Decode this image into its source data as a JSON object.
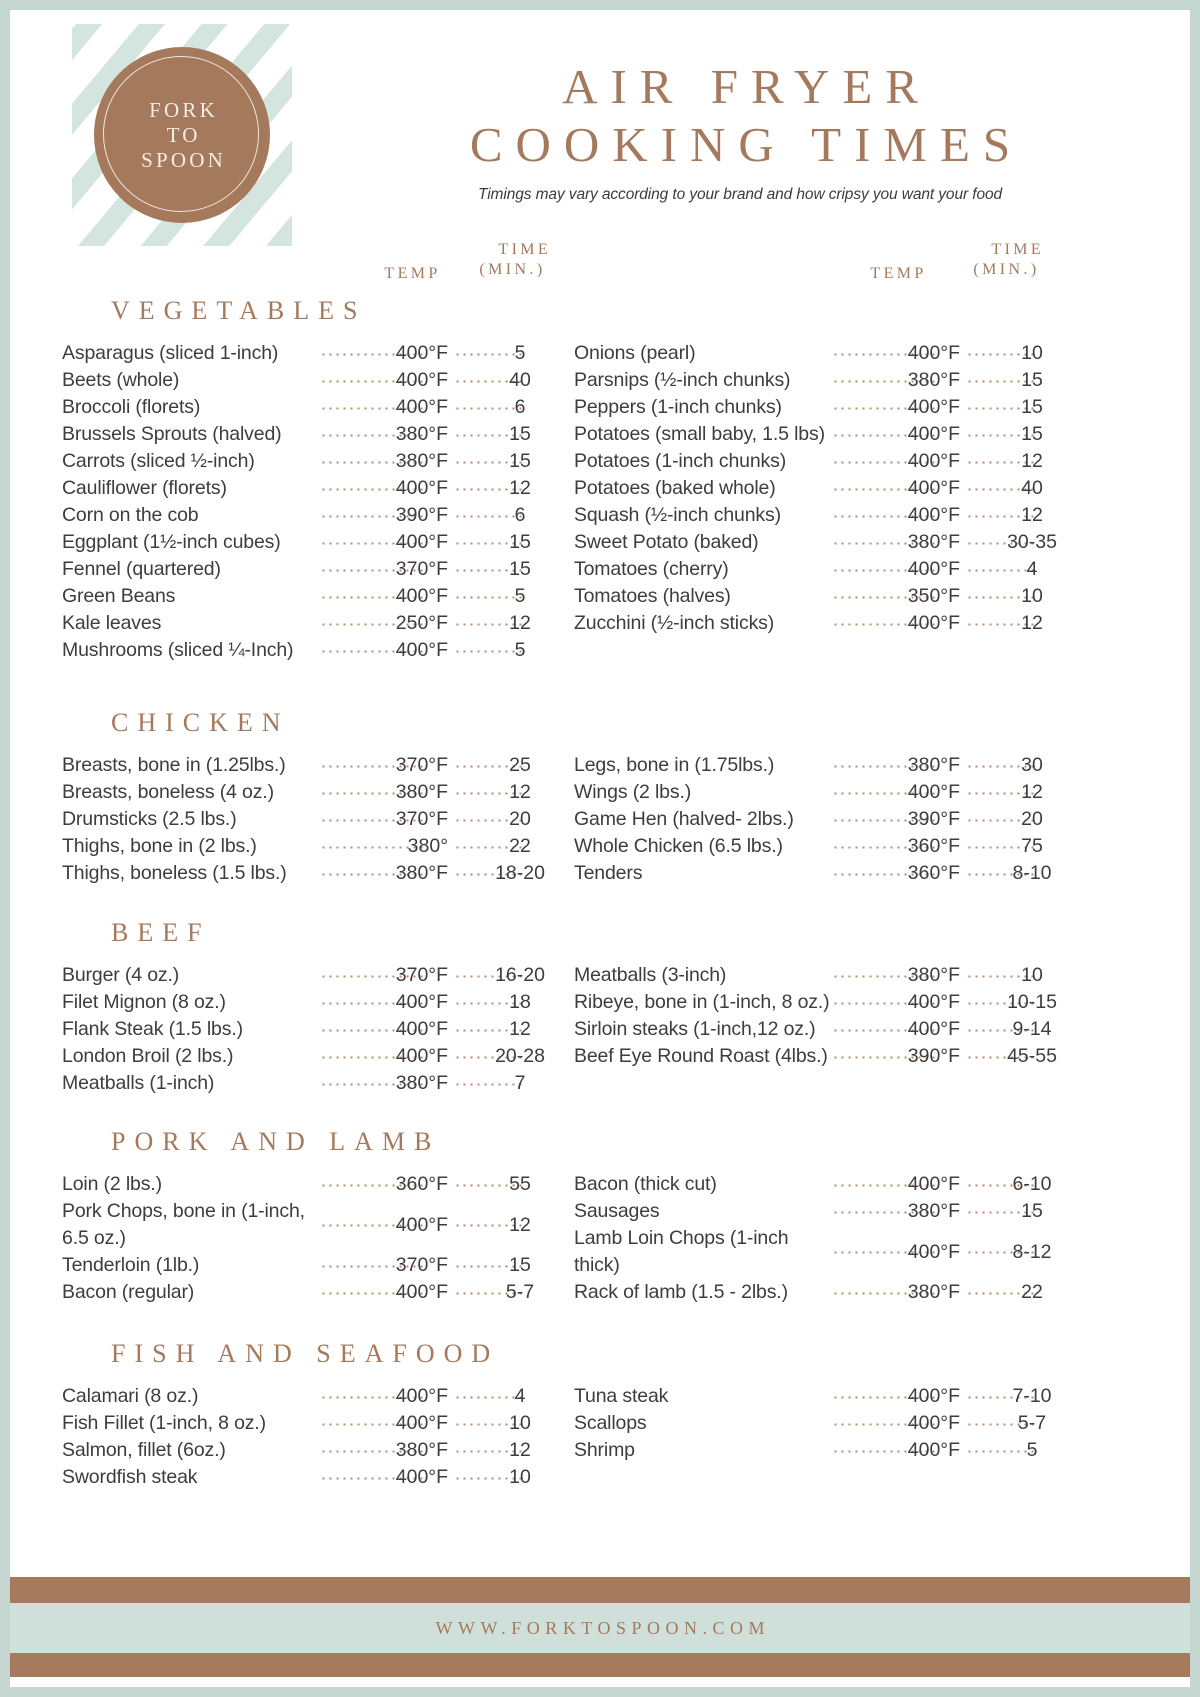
{
  "brand": {
    "logo_line1": "FORK",
    "logo_line2": "TO",
    "logo_line3": "SPOON",
    "website": "WWW.FORKTOSPOON.COM"
  },
  "header": {
    "title_line1": "AIR FRYER",
    "title_line2": "COOKING TIMES",
    "subtitle": "Timings may vary according to your brand and how cripsy you want your food",
    "col_temp_left": "TEMP",
    "col_time_left_1": "TIME",
    "col_time_left_2": "(MIN.)",
    "col_temp_right": "TEMP",
    "col_time_right_1": "TIME",
    "col_time_right_2": "(MIN.)"
  },
  "colors": {
    "brown": "#a5795c",
    "mint": "#cfe0da",
    "text": "#3d3d3d",
    "dots": "#b98a6c"
  },
  "sections": [
    {
      "title": "VEGETABLES",
      "left": [
        {
          "name": "Asparagus (sliced 1-inch)",
          "temp": "400°F",
          "time": "5"
        },
        {
          "name": "Beets (whole)",
          "temp": "400°F",
          "time": "40"
        },
        {
          "name": "Broccoli (florets)",
          "temp": "400°F",
          "time": "6"
        },
        {
          "name": "Brussels Sprouts (halved)",
          "temp": "380°F",
          "time": "15"
        },
        {
          "name": "Carrots (sliced ½-inch)",
          "temp": "380°F",
          "time": "15"
        },
        {
          "name": "Cauliflower (florets)",
          "temp": "400°F",
          "time": "12"
        },
        {
          "name": "Corn on the cob",
          "temp": "390°F",
          "time": "6"
        },
        {
          "name": "Eggplant (1½-inch cubes)",
          "temp": "400°F",
          "time": "15"
        },
        {
          "name": "Fennel (quartered)",
          "temp": "370°F",
          "time": "15"
        },
        {
          "name": "Green Beans",
          "temp": "400°F",
          "time": "5"
        },
        {
          "name": "Kale leaves",
          "temp": "250°F",
          "time": "12"
        },
        {
          "name": "Mushrooms (sliced ¼-Inch)",
          "temp": "400°F",
          "time": "5"
        }
      ],
      "right": [
        {
          "name": "Onions (pearl)",
          "temp": "400°F",
          "time": "10"
        },
        {
          "name": "Parsnips (½-inch chunks)",
          "temp": "380°F",
          "time": "15"
        },
        {
          "name": "Peppers (1-inch chunks)",
          "temp": "400°F",
          "time": "15"
        },
        {
          "name": "Potatoes (small baby, 1.5 lbs)",
          "temp": "400°F",
          "time": "15"
        },
        {
          "name": "Potatoes (1-inch chunks)",
          "temp": "400°F",
          "time": "12"
        },
        {
          "name": "Potatoes (baked whole)",
          "temp": "400°F",
          "time": "40"
        },
        {
          "name": "Squash (½-inch chunks)",
          "temp": "400°F",
          "time": "12"
        },
        {
          "name": "Sweet Potato (baked)",
          "temp": "380°F",
          "time": "30-35"
        },
        {
          "name": "Tomatoes (cherry)",
          "temp": "400°F",
          "time": "4"
        },
        {
          "name": "Tomatoes (halves)",
          "temp": "350°F",
          "time": "10"
        },
        {
          "name": "Zucchini (½-inch sticks)",
          "temp": "400°F",
          "time": "12"
        }
      ]
    },
    {
      "title": "CHICKEN",
      "left": [
        {
          "name": "Breasts, bone in (1.25lbs.)",
          "temp": "370°F",
          "time": "25"
        },
        {
          "name": "Breasts, boneless (4 oz.)",
          "temp": "380°F",
          "time": "12"
        },
        {
          "name": "Drumsticks (2.5 lbs.)",
          "temp": "370°F",
          "time": "20"
        },
        {
          "name": "Thighs, bone in (2 lbs.)",
          "temp": "380°",
          "time": "22"
        },
        {
          "name": "Thighs, boneless (1.5 lbs.)",
          "temp": "380°F",
          "time": "18-20"
        }
      ],
      "right": [
        {
          "name": "Legs, bone in (1.75lbs.)",
          "temp": "380°F",
          "time": "30"
        },
        {
          "name": "Wings (2 lbs.)",
          "temp": "400°F",
          "time": "12"
        },
        {
          "name": "Game Hen (halved- 2lbs.)",
          "temp": "390°F",
          "time": "20"
        },
        {
          "name": "Whole Chicken (6.5 lbs.)",
          "temp": "360°F",
          "time": "75"
        },
        {
          "name": "Tenders",
          "temp": "360°F",
          "time": "8-10"
        }
      ]
    },
    {
      "title": "BEEF",
      "left": [
        {
          "name": "Burger (4 oz.)",
          "temp": "370°F",
          "time": "16-20"
        },
        {
          "name": "Filet Mignon (8 oz.)",
          "temp": "400°F",
          "time": "18"
        },
        {
          "name": "Flank Steak (1.5 lbs.)",
          "temp": "400°F",
          "time": "12"
        },
        {
          "name": "London Broil (2 lbs.)",
          "temp": "400°F",
          "time": "20-28"
        },
        {
          "name": "Meatballs (1-inch)",
          "temp": "380°F",
          "time": "7"
        }
      ],
      "right": [
        {
          "name": "Meatballs (3-inch)",
          "temp": "380°F",
          "time": "10"
        },
        {
          "name": "Ribeye, bone in (1-inch, 8 oz.)",
          "temp": "400°F",
          "time": "10-15"
        },
        {
          "name": "Sirloin steaks (1-inch,12 oz.)",
          "temp": "400°F",
          "time": "9-14"
        },
        {
          "name": "Beef Eye Round Roast (4lbs.)",
          "temp": "390°F",
          "time": "45-55"
        }
      ]
    },
    {
      "title": "PORK AND LAMB",
      "left": [
        {
          "name": "Loin (2 lbs.)",
          "temp": "360°F",
          "time": "55",
          "tall": false
        },
        {
          "name": "Pork Chops, bone in (1-inch, 6.5 oz.)",
          "temp": "400°F",
          "time": "12",
          "tall": true
        },
        {
          "name": "Tenderloin (1lb.)",
          "temp": "370°F",
          "time": "15",
          "tall": false
        },
        {
          "name": "Bacon (regular)",
          "temp": "400°F",
          "time": "5-7",
          "tall": false
        }
      ],
      "right": [
        {
          "name": "Bacon (thick cut)",
          "temp": "400°F",
          "time": "6-10",
          "tall": false
        },
        {
          "name": "Sausages",
          "temp": "380°F",
          "time": "15",
          "tall": false
        },
        {
          "name": "Lamb Loin Chops (1-inch thick)",
          "temp": "400°F",
          "time": "8-12",
          "tall": true
        },
        {
          "name": "Rack of lamb (1.5 - 2lbs.)",
          "temp": "380°F",
          "time": "22",
          "tall": false
        }
      ]
    },
    {
      "title": "FISH AND SEAFOOD",
      "left": [
        {
          "name": "Calamari (8 oz.)",
          "temp": "400°F",
          "time": "4"
        },
        {
          "name": "Fish Fillet (1-inch, 8 oz.)",
          "temp": "400°F",
          "time": "10"
        },
        {
          "name": "Salmon, fillet (6oz.)",
          "temp": "380°F",
          "time": "12"
        },
        {
          "name": "Swordfish steak",
          "temp": "400°F",
          "time": "10"
        }
      ],
      "right": [
        {
          "name": "Tuna steak",
          "temp": "400°F",
          "time": "7-10"
        },
        {
          "name": "Scallops",
          "temp": "400°F",
          "time": "5-7"
        },
        {
          "name": "Shrimp",
          "temp": "400°F",
          "time": "5"
        }
      ]
    }
  ],
  "layout": {
    "section_tops": [
      282,
      694,
      904,
      1113,
      1325
    ],
    "section_heights": [
      400,
      198,
      197,
      200,
      250
    ]
  }
}
